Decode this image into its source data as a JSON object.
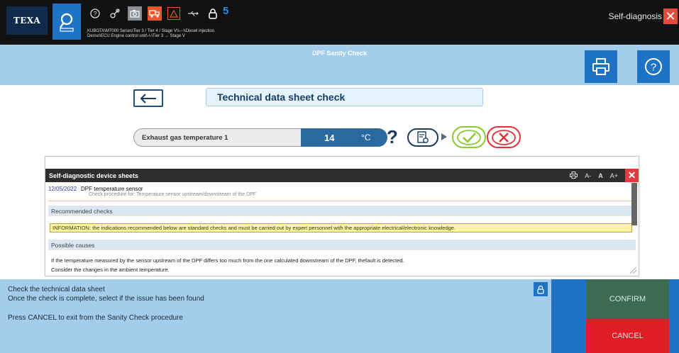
{
  "topbar": {
    "logo": "TEXA",
    "vehicle_path_line1": "KUBOTA\\M7000 Series\\Tier 3 / Tier 4 / Stage V\\\\---\\\\Diesel injection",
    "vehicle_path_line2": "Denso\\ECU Engine control unit\\-\\-\\Tier 3 → Stage V",
    "badge_count": "5",
    "mode_label": "Self-diagnosis",
    "icons": [
      "question-circle-icon",
      "key-icon",
      "camera-icon",
      "truck-icon",
      "warning-icon",
      "usb-icon",
      "lock-icon"
    ]
  },
  "header": {
    "title": "DPF Sanity Check"
  },
  "check": {
    "title": "Technical data sheet check",
    "measure_label": "Exhaust gas temperature 1",
    "measure_value": "14",
    "measure_unit": "°C"
  },
  "sheet": {
    "bar_title": "Self-diagnostic device sheets",
    "tools": [
      "A-",
      "A",
      "A+"
    ],
    "entry_date": "12/05/2022",
    "entry_title": "DPF temperature sensor",
    "entry_subtitle": "Check procedure for: Temperature sensor upstream/downstream of the DPF",
    "section_recommended": "Recommended checks",
    "info_text": "INFORMATION: the indications recommended below are standard checks and must be carried out by expert personnel with the appropriate electrical/electronic knowledge.",
    "section_causes": "Possible causes",
    "cause_line1": "If the temperature measured by the sensor upstream of the DPF differs too much from the one calculated downstream of the DPF, thefault is detected.",
    "cause_line2": "Consider the changes in the ambient temperature."
  },
  "instructions": {
    "line1": "Check the technical data sheet",
    "line2": "Once the check is complete, select if the issue has been found",
    "line3": "Press CANCEL to exit from the Sanity Check procedure"
  },
  "actions": {
    "confirm": "CONFIRM",
    "cancel": "CANCEL"
  },
  "colors": {
    "accent_blue": "#1f73c4",
    "light_blue": "#a3cdea",
    "confirm_green": "#3c6b54",
    "cancel_red": "#e01c24",
    "ok_green": "#8acb33"
  }
}
